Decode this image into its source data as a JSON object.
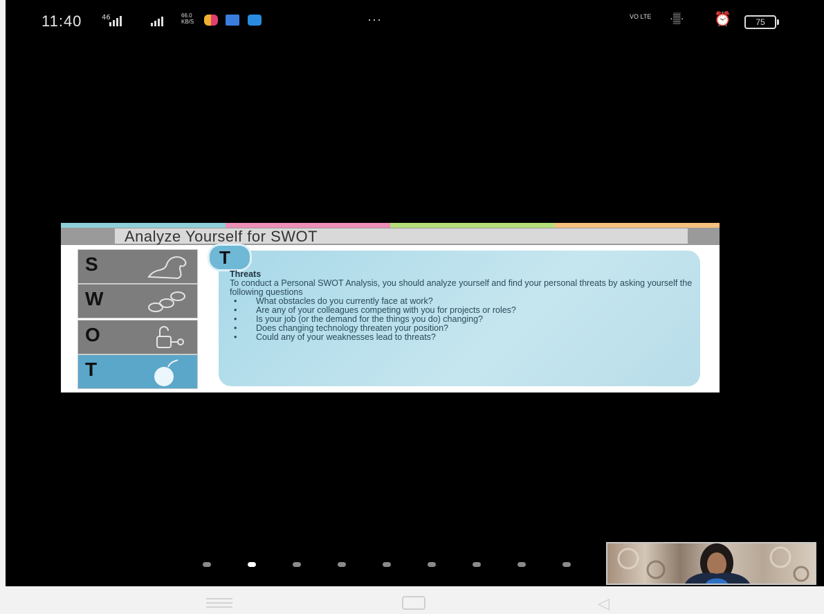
{
  "status_bar": {
    "time": "11:40",
    "signal1_label": "46",
    "net_speed_value": "66.0",
    "net_speed_unit": "KB/S",
    "overflow": "···",
    "volte_label": "VO LTE",
    "battery": "75",
    "colors": {
      "app1": "#f0b030",
      "app2": "#3b7ddd",
      "app3": "#2a8be0"
    }
  },
  "slide": {
    "title": "Analyze Yourself for SWOT",
    "stripe_colors": [
      "#8fd0d8",
      "#ee8fb8",
      "#b8e07a",
      "#f4c27d"
    ],
    "tiles": [
      {
        "letter": "S",
        "icon": "muscle-arm-icon"
      },
      {
        "letter": "W",
        "icon": "broken-chain-icon"
      },
      {
        "letter": "O",
        "icon": "unlocked-padlock-icon"
      },
      {
        "letter": "T",
        "icon": "bomb-icon"
      }
    ],
    "active_letter": "T",
    "heading": "Threats",
    "intro": "To conduct a Personal SWOT Analysis, you should analyze yourself and find your personal threats by asking yourself the following questions",
    "bullets": [
      "What obstacles do you currently face at work?",
      "Are any of your colleagues competing with you for projects or roles?",
      "Is your job (or the demand for the things you do) changing?",
      "Does changing technology threaten your position?",
      "Could any of your weaknesses lead to threats?"
    ]
  },
  "pager": {
    "count": 9,
    "active_index": 1
  },
  "video_tile": {
    "icon": "participant-video-thumbnail"
  },
  "nav_bar": {
    "menu_icon": "menu-icon",
    "home_icon": "home-icon",
    "back_icon": "back-icon"
  }
}
